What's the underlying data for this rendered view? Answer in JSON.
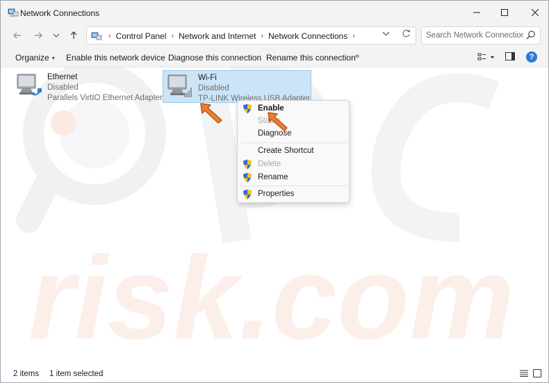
{
  "window": {
    "title": "Network Connections"
  },
  "navigation": {
    "breadcrumbs": [
      "Control Panel",
      "Network and Internet",
      "Network Connections"
    ],
    "search_placeholder": "Search Network Connections"
  },
  "toolbar": {
    "organize": "Organize",
    "enable": "Enable this network device",
    "diagnose": "Diagnose this connection",
    "rename": "Rename this connection",
    "more": "»"
  },
  "items": [
    {
      "name": "Ethernet",
      "status": "Disabled",
      "adapter": "Parallels VirtIO Ethernet Adapter",
      "selected": false
    },
    {
      "name": "Wi-Fi",
      "status": "Disabled",
      "adapter": "TP-LINK Wireless USB Adapter",
      "selected": true
    }
  ],
  "context_menu": {
    "enable": "Enable",
    "status": "Status",
    "diagnose": "Diagnose",
    "create_shortcut": "Create Shortcut",
    "delete": "Delete",
    "rename": "Rename",
    "properties": "Properties"
  },
  "statusbar": {
    "count": "2 items",
    "selection": "1 item selected"
  },
  "watermark": {
    "text": "risk.com"
  },
  "colors": {
    "selection_bg": "#cce4f7",
    "selection_border": "#99c9ef",
    "arrow": "#e8731f",
    "accent": "#2b7bd9"
  }
}
